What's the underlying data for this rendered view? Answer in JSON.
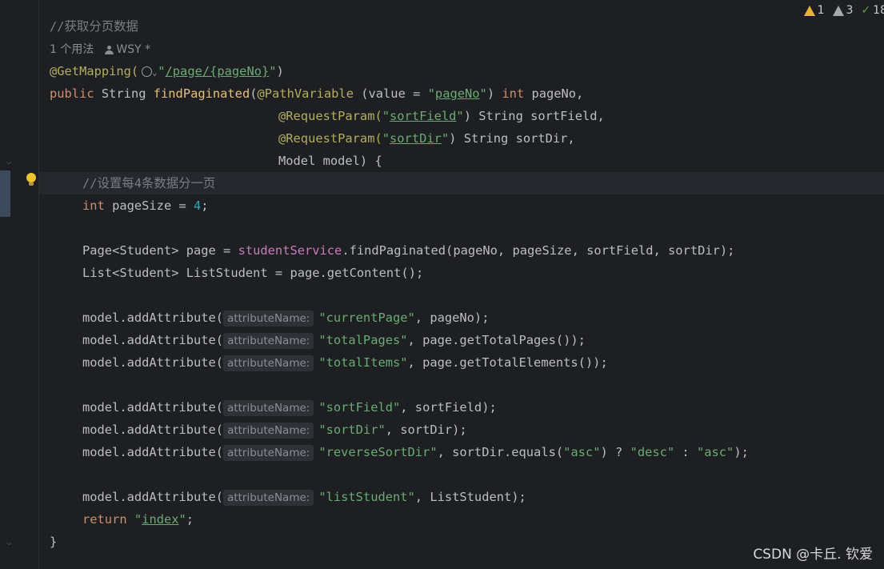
{
  "status": {
    "warnings": "1",
    "weak_warnings": "3",
    "typos": "18"
  },
  "code": {
    "l1": {
      "comment": "//获取分页数据"
    },
    "l2": {
      "usages": "1 个用法",
      "author": "WSY *"
    },
    "l3": {
      "annotation": "@GetMapping(",
      "q1": "\"",
      "path": "/page/{pageNo}",
      "q2": "\"",
      "close": ")"
    },
    "l4": {
      "kw_public": "public",
      "t1": " String ",
      "method": "findPaginated",
      "p1": "(",
      "ann": "@PathVariable",
      "t2": " (value = ",
      "q1": "\"",
      "s": "pageNo",
      "q2": "\"",
      "t3": ") ",
      "kw_int": "int",
      "t4": " pageNo,",
      "indent": ""
    },
    "l5": {
      "ann": "@RequestParam(",
      "q1": "\"",
      "s": "sortField",
      "q2": "\"",
      "t": ") String sortField,"
    },
    "l6": {
      "ann": "@RequestParam(",
      "q1": "\"",
      "s": "sortDir",
      "q2": "\"",
      "t": ") String sortDir,"
    },
    "l7": {
      "t": "Model model) {"
    },
    "l8": {
      "comment": "//设置每4条数据分一页"
    },
    "l9": {
      "kw": "int",
      "t": " pageSize = ",
      "num": "4",
      "end": ";"
    },
    "l11": {
      "t1": "Page<Student> page = ",
      "field": "studentService",
      "t2": ".findPaginated(pageNo, pageSize, sortField, sortDir);"
    },
    "l12": {
      "t": "List<Student> ListStudent = page.getContent();"
    },
    "hint": "attributeName:",
    "l14": {
      "t1": "model.addAttribute(",
      "s": "\"currentPage\"",
      "t2": ", pageNo);"
    },
    "l15": {
      "t1": "model.addAttribute(",
      "s": "\"totalPages\"",
      "t2": ", page.getTotalPages());"
    },
    "l16": {
      "t1": "model.addAttribute(",
      "s": "\"totalItems\"",
      "t2": ", page.getTotalElements());"
    },
    "l18": {
      "t1": "model.addAttribute(",
      "s": "\"sortField\"",
      "t2": ", sortField);"
    },
    "l19": {
      "t1": "model.addAttribute(",
      "s": "\"sortDir\"",
      "t2": ", sortDir);"
    },
    "l20": {
      "t1": "model.addAttribute(",
      "s": "\"reverseSortDir\"",
      "t2": ", sortDir.equals(",
      "s2": "\"asc\"",
      "t3": ") ? ",
      "s3": "\"desc\"",
      "t4": " : ",
      "s4": "\"asc\"",
      "t5": ");"
    },
    "l22": {
      "t1": "model.addAttribute(",
      "s": "\"listStudent\"",
      "t2": ", ListStudent);"
    },
    "l23": {
      "kw": "return",
      "sp": " ",
      "q1": "\"",
      "s": "index",
      "q2": "\"",
      "end": ";"
    },
    "l24": {
      "t": "}"
    }
  },
  "watermark": "CSDN @卡丘. 钦爱"
}
